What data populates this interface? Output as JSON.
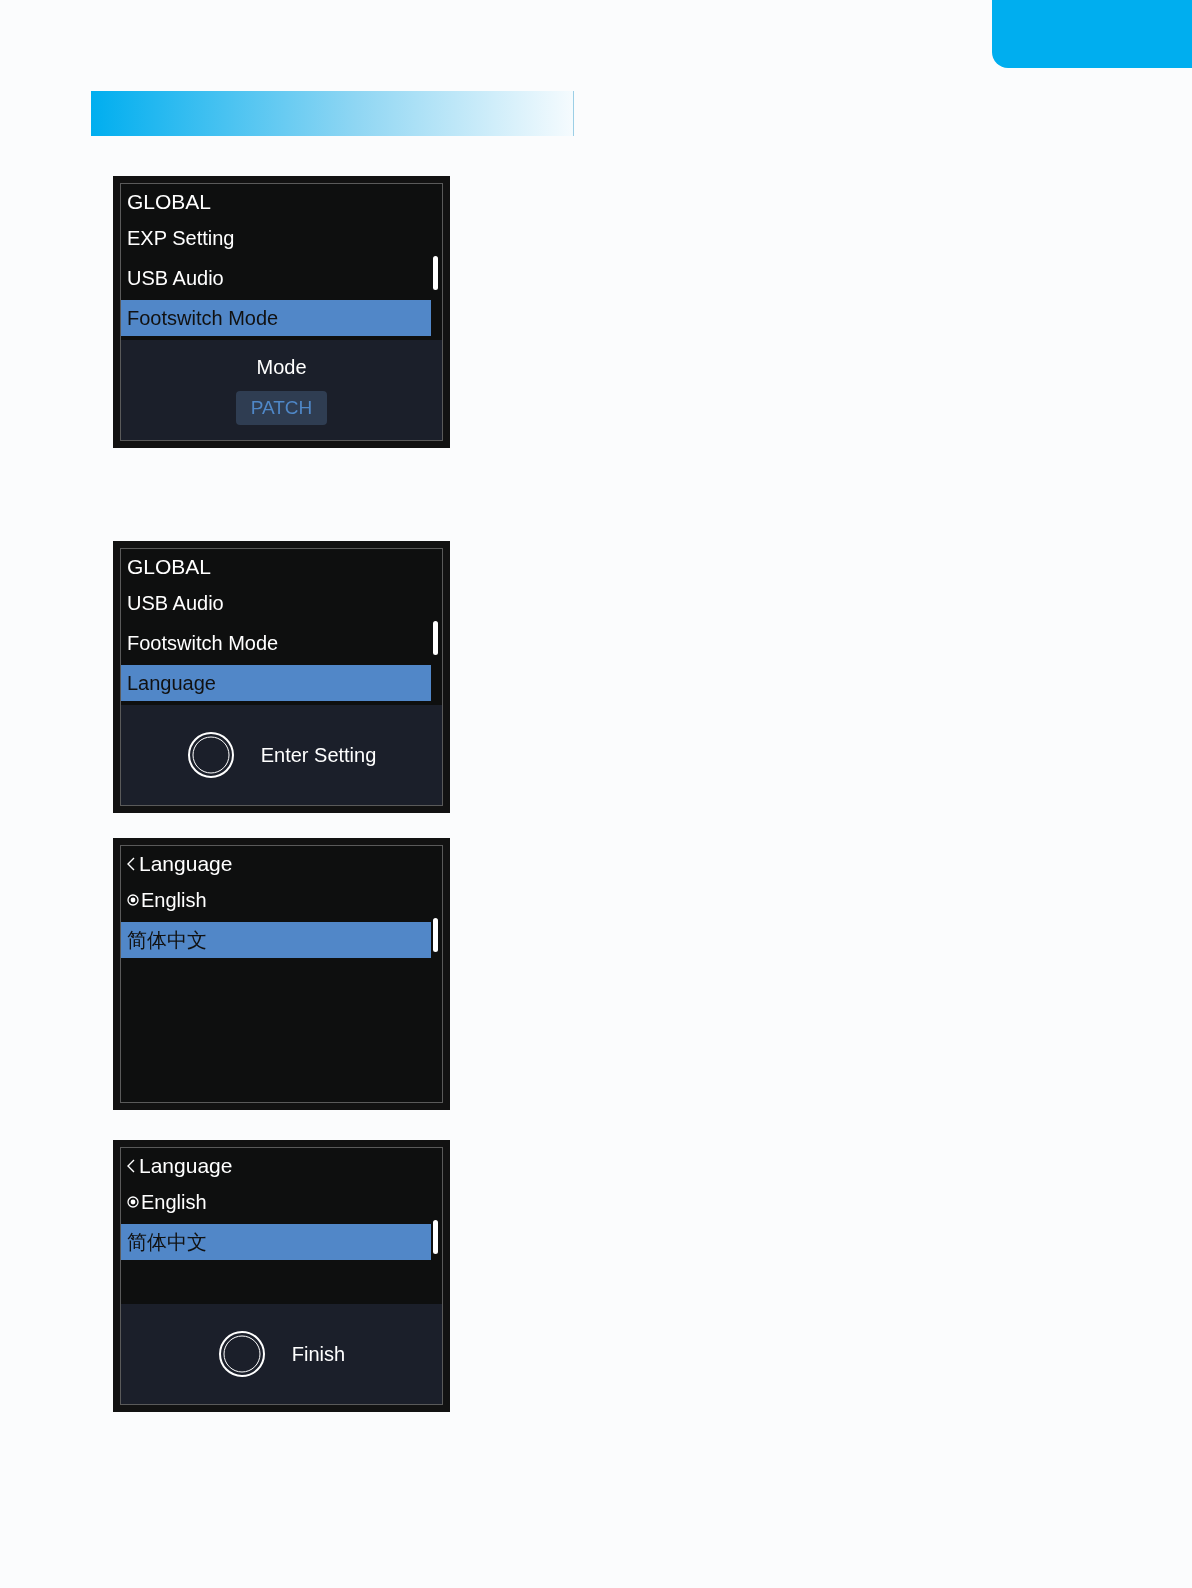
{
  "screens": [
    {
      "title": "GLOBAL",
      "back": false,
      "kind": "menu",
      "items": [
        {
          "label": "EXP Setting",
          "selected": false
        },
        {
          "label": "USB Audio",
          "selected": false
        },
        {
          "label": "Footswitch Mode",
          "selected": true
        }
      ],
      "footer": {
        "kind": "value",
        "label": "Mode",
        "value": "PATCH"
      }
    },
    {
      "title": "GLOBAL",
      "back": false,
      "kind": "menu",
      "items": [
        {
          "label": "USB Audio",
          "selected": false
        },
        {
          "label": "Footswitch Mode",
          "selected": false
        },
        {
          "label": "Language",
          "selected": true
        }
      ],
      "footer": {
        "kind": "action",
        "label": "Enter Setting"
      }
    },
    {
      "title": "Language",
      "back": true,
      "kind": "options",
      "items": [
        {
          "label": "English",
          "selected": false,
          "checked": true
        },
        {
          "label": "简体中文",
          "selected": true,
          "checked": false
        }
      ]
    },
    {
      "title": "Language",
      "back": true,
      "kind": "options",
      "items": [
        {
          "label": "English",
          "selected": false,
          "checked": true
        },
        {
          "label": "简体中文",
          "selected": true,
          "checked": false
        }
      ],
      "footer": {
        "kind": "action",
        "label": "Finish"
      }
    }
  ]
}
